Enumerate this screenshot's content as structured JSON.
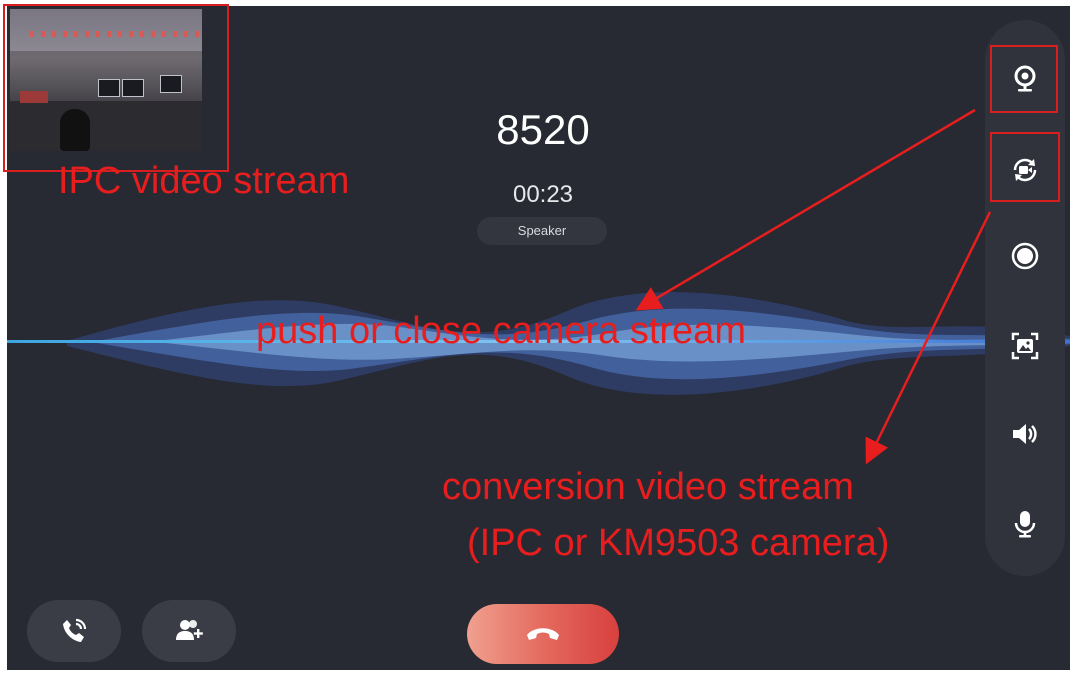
{
  "call": {
    "number": "8520",
    "timer": "00:23",
    "audio_route": "Speaker"
  },
  "ipc_thumbnail": {
    "icon": "ipc-video-preview"
  },
  "side_toolbar": {
    "items": [
      {
        "icon": "webcam-icon"
      },
      {
        "icon": "switch-camera-icon"
      },
      {
        "icon": "record-icon"
      },
      {
        "icon": "screenshot-icon"
      },
      {
        "icon": "volume-icon"
      },
      {
        "icon": "microphone-icon"
      }
    ]
  },
  "bottom_bar": {
    "transfer_icon": "call-transfer-icon",
    "add_participant_icon": "add-user-icon",
    "hangup_icon": "hangup-icon"
  },
  "annotations": {
    "ipc_stream": "IPC video stream",
    "push_close": "push or close camera stream",
    "conversion_line1": "conversion video stream",
    "conversion_line2": "(IPC or KM9503 camera)"
  },
  "colors": {
    "background": "#272a33",
    "annotation": "#e81e1e",
    "hangup_gradient_start": "#f0a090",
    "hangup_gradient_end": "#d8403e",
    "wave": "#4f8fe6"
  }
}
